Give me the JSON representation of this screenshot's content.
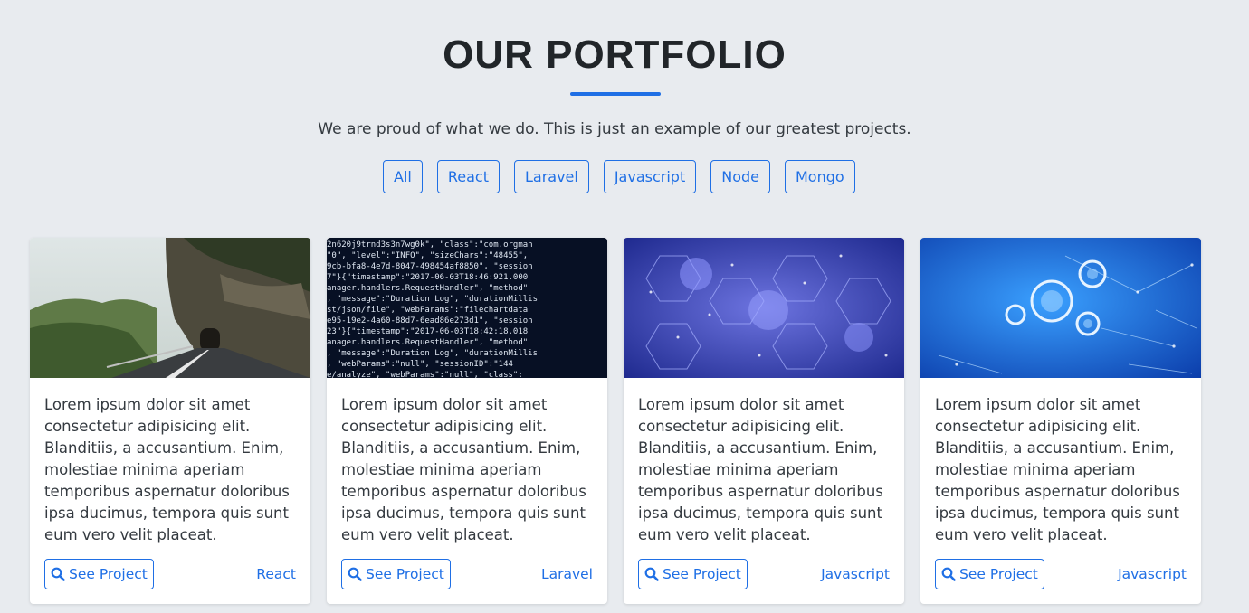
{
  "header": {
    "title": "OUR PORTFOLIO",
    "subtitle": "We are proud of what we do. This is just an example of our greatest projects."
  },
  "filters": [
    "All",
    "React",
    "Laravel",
    "Javascript",
    "Node",
    "Mongo"
  ],
  "cards": [
    {
      "image": "mountain-road-photo",
      "text": "Lorem ipsum dolor sit amet consectetur adipisicing elit. Blanditiis, a accusantium. Enim, molestiae minima aperiam temporibus aspernatur doloribus ipsa ducimus, tempora quis sunt eum vero velit placeat.",
      "button": "See Project",
      "tag": "React"
    },
    {
      "image": "code-screen-photo",
      "text": "Lorem ipsum dolor sit amet consectetur adipisicing elit. Blanditiis, a accusantium. Enim, molestiae minima aperiam temporibus aspernatur doloribus ipsa ducimus, tempora quis sunt eum vero velit placeat.",
      "button": "See Project",
      "tag": "Laravel"
    },
    {
      "image": "hexagon-network-photo",
      "text": "Lorem ipsum dolor sit amet consectetur adipisicing elit. Blanditiis, a accusantium. Enim, molestiae minima aperiam temporibus aspernatur doloribus ipsa ducimus, tempora quis sunt eum vero velit placeat.",
      "button": "See Project",
      "tag": "Javascript"
    },
    {
      "image": "gears-network-photo",
      "text": "Lorem ipsum dolor sit amet consectetur adipisicing elit. Blanditiis, a accusantium. Enim, molestiae minima aperiam temporibus aspernatur doloribus ipsa ducimus, tempora quis sunt eum vero velit placeat.",
      "button": "See Project",
      "tag": "Javascript"
    }
  ],
  "colors": {
    "accent": "#1f6fe5",
    "background": "#e8ebef",
    "card": "#ffffff"
  }
}
